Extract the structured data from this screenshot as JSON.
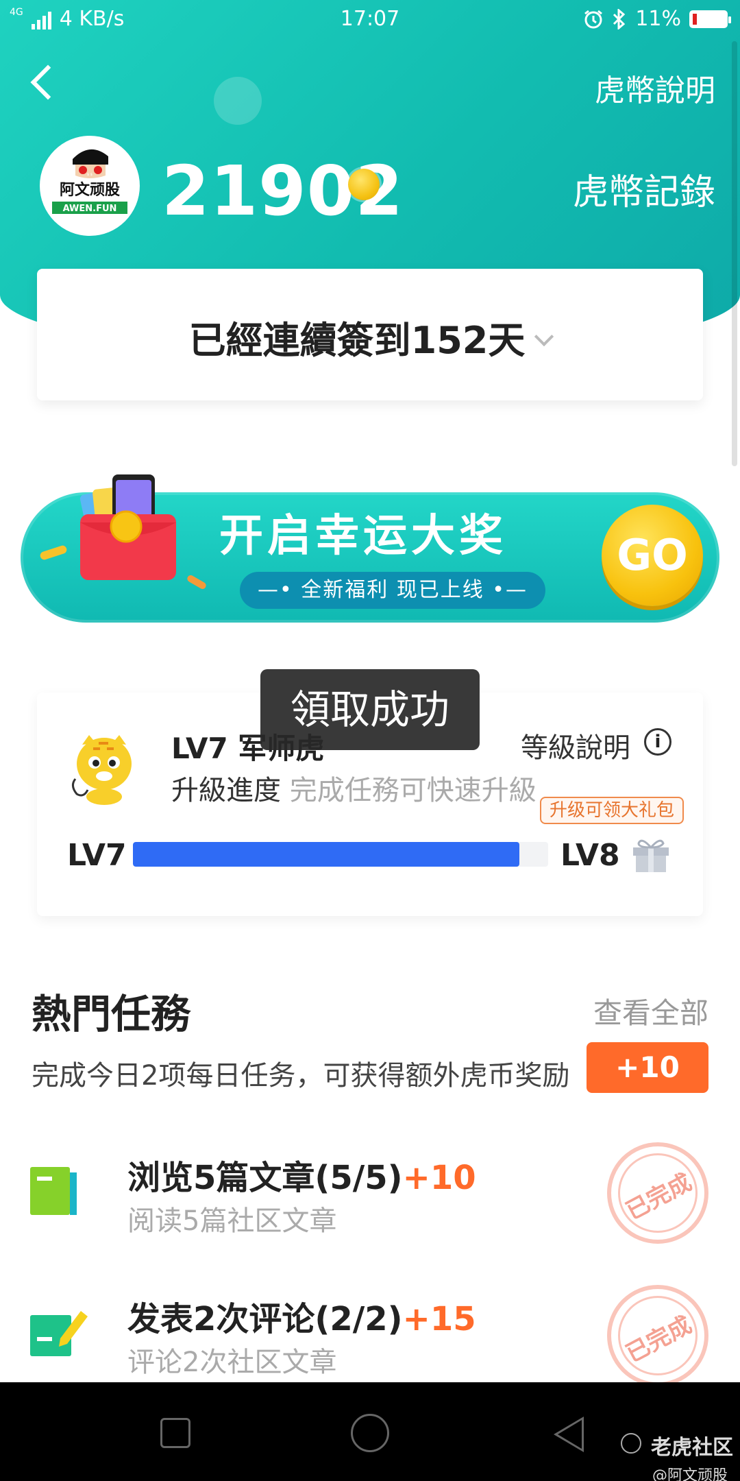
{
  "status_bar": {
    "network": "4G",
    "speed": "4 KB/s",
    "time": "17:07",
    "battery": "11%",
    "battery_level": 0.11
  },
  "header": {
    "explain_link": "虎幣說明",
    "record_link": "虎幣記錄",
    "balance": "21902",
    "avatar_text_top": "阿文顽股",
    "avatar_text_bottom": "AWEN.FUN"
  },
  "checkin": {
    "text": "已經連續簽到152天"
  },
  "banner": {
    "title": "开启幸运大奖",
    "subtitle": "—• 全新福利 现已上线 •—",
    "go_label": "GO"
  },
  "toast": {
    "text": "領取成功"
  },
  "level": {
    "name": "LV7 军师虎",
    "progress_label": "升級進度",
    "progress_hint": "完成任務可快速升級",
    "explain_label": "等級說明",
    "info_icon": "i",
    "from_level": "LV7",
    "to_level": "LV8",
    "progress": 0.93,
    "gift_tip": "升级可领大礼包"
  },
  "hot_tasks": {
    "title": "熱門任務",
    "see_all": "查看全部",
    "description": "完成今日2项每日任务，可获得额外虎币奖励",
    "bonus": "+10",
    "items": [
      {
        "title": "浏览5篇文章(5/5)",
        "reward": "+10",
        "subtitle": "阅读5篇社区文章",
        "status": "已完成",
        "icon": "book-icon"
      },
      {
        "title": "发表2次评论(2/2)",
        "reward": "+15",
        "subtitle": "评论2次社区文章",
        "status": "已完成",
        "icon": "comment-edit-icon"
      }
    ]
  },
  "watermark": {
    "brand": "老虎社区",
    "handle": "@阿文顽股"
  },
  "colors": {
    "hero": "#14c2b6",
    "accent_orange": "#ff6a2a",
    "progress_blue": "#2f6bf5",
    "go_yellow": "#f8c20e"
  }
}
